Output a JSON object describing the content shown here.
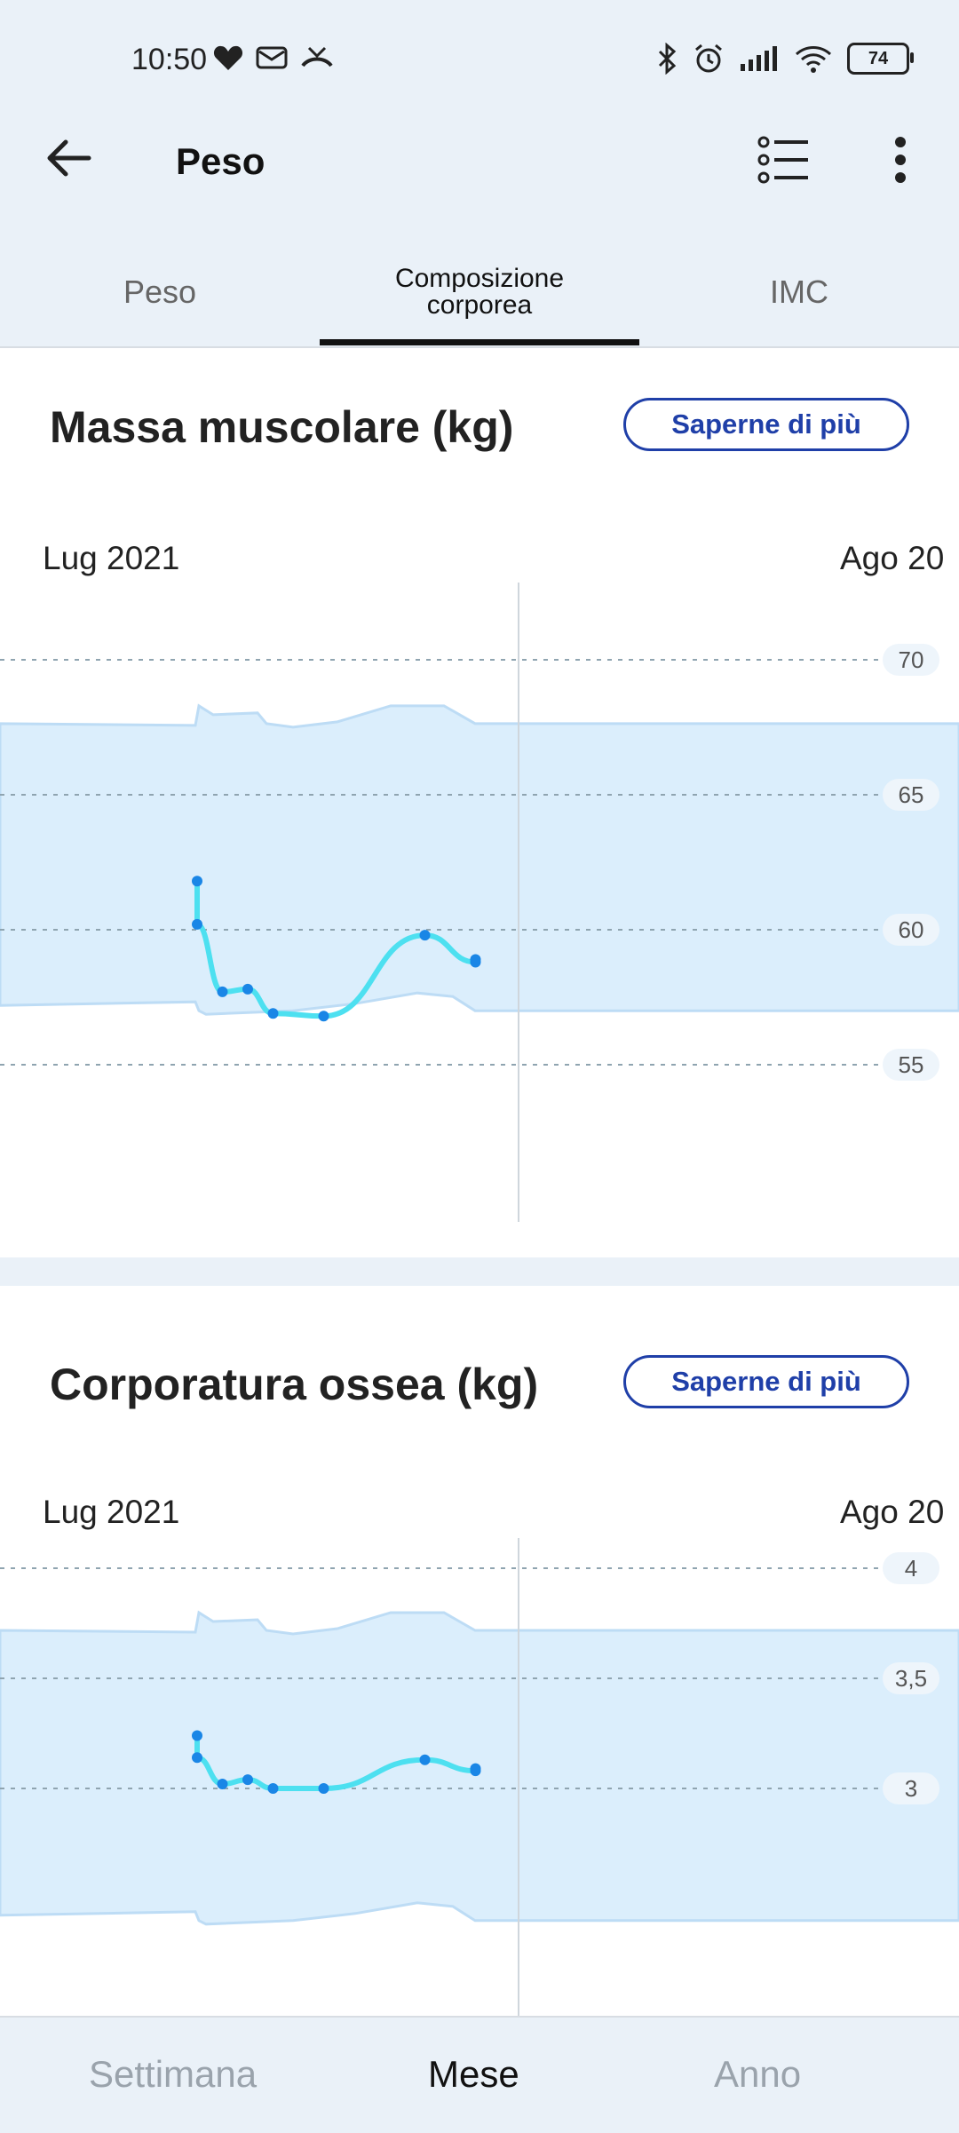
{
  "status": {
    "time": "10:50",
    "battery": "74"
  },
  "appbar": {
    "title": "Peso"
  },
  "tabs": [
    {
      "label": "Peso"
    },
    {
      "label": "Composizione\ncorporea",
      "active": true
    },
    {
      "label": "IMC"
    }
  ],
  "cards": [
    {
      "title": "Massa muscolare (kg)",
      "more_label": "Saperne di più",
      "month_left": "Lug 2021",
      "month_right": "Ago 20",
      "chart_data": {
        "type": "line",
        "ylabel": "Massa muscolare (kg)",
        "y_ticks": [
          "70",
          "65",
          "60",
          "55"
        ],
        "ylim": [
          52,
          74
        ],
        "band_upper": 67.9,
        "band_lower": 57.0,
        "series": [
          {
            "values": [
              [
                1,
                61.8
              ],
              [
                1,
                60.2
              ],
              [
                2,
                57.7
              ],
              [
                3,
                57.8
              ],
              [
                4,
                56.9
              ],
              [
                6,
                56.8
              ],
              [
                10,
                59.8
              ],
              [
                12,
                58.8
              ],
              [
                12,
                58.9
              ]
            ]
          }
        ]
      }
    },
    {
      "title": "Corporatura ossea (kg)",
      "more_label": "Saperne di più",
      "month_left": "Lug 2021",
      "month_right": "Ago 20",
      "chart_data": {
        "type": "line",
        "ylabel": "Corporatura ossea (kg)",
        "y_ticks": [
          "4",
          "3,5",
          "3"
        ],
        "ylim": [
          2.4,
          4.2
        ],
        "band_upper": 3.75,
        "band_lower": 2.4,
        "series": [
          {
            "values": [
              [
                1,
                3.24
              ],
              [
                1,
                3.14
              ],
              [
                2,
                3.02
              ],
              [
                3,
                3.04
              ],
              [
                4,
                3.0
              ],
              [
                6,
                3.0
              ],
              [
                10,
                3.13
              ],
              [
                12,
                3.08
              ],
              [
                12,
                3.09
              ]
            ]
          }
        ]
      }
    }
  ],
  "bottom_tabs": [
    {
      "label": "Settimana"
    },
    {
      "label": "Mese",
      "active": true
    },
    {
      "label": "Anno"
    }
  ],
  "colors": {
    "accent": "#1f3fa8",
    "band": "#dbeefc",
    "line": "#4de0f0",
    "point": "#1a86e6"
  }
}
